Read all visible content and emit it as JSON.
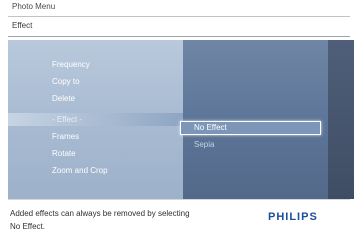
{
  "header": {
    "menu_title": "Photo Menu",
    "breadcrumb": "Effect"
  },
  "menu": {
    "items": [
      {
        "label": "Frequency"
      },
      {
        "label": "Copy to"
      },
      {
        "label": "Delete"
      },
      {
        "label": "- Effect -",
        "selected": true
      },
      {
        "label": "Frames"
      },
      {
        "label": "Rotate"
      },
      {
        "label": "Zoom and Crop"
      }
    ]
  },
  "submenu": {
    "options": [
      {
        "label": "No Effect",
        "highlighted": true
      },
      {
        "label": "Sepia"
      }
    ]
  },
  "footer": {
    "hint_line1": "Added effects can always be removed by selecting",
    "hint_line2": "No Effect.",
    "brand": "PHILIPS"
  },
  "colors": {
    "brand_blue": "#1a4f9a",
    "left_panel": "#a8bbd2",
    "middle_panel": "#5c7497",
    "right_panel": "#3f4d64"
  }
}
